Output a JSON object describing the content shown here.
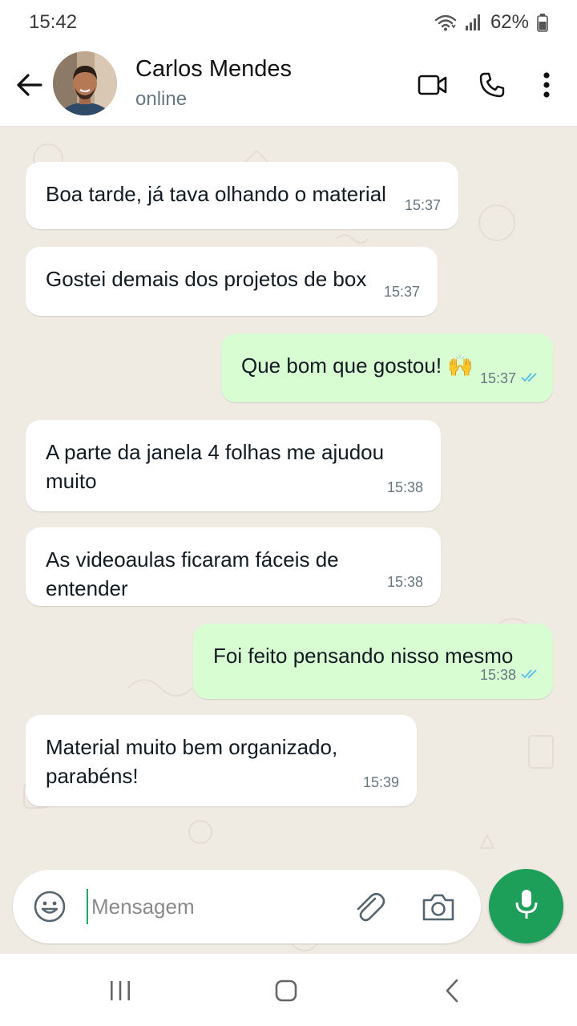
{
  "status_bar": {
    "time": "15:42",
    "battery": "62%",
    "icons": [
      "wifi-icon",
      "signal-icon",
      "battery-icon"
    ]
  },
  "header": {
    "contact_name": "Carlos Mendes",
    "contact_status": "online",
    "icons": [
      "back-arrow-icon",
      "video-call-icon",
      "voice-call-icon",
      "more-options-icon"
    ]
  },
  "messages": [
    {
      "direction": "in",
      "text": "Boa tarde, já tava olhando o material",
      "time": "15:37"
    },
    {
      "direction": "in",
      "text": "Gostei demais dos projetos de box",
      "time": "15:37"
    },
    {
      "direction": "out",
      "text": "Que bom que gostou! 🙌",
      "time": "15:37",
      "read": true
    },
    {
      "direction": "in",
      "text": "A parte da janela 4 folhas me ajudou muito",
      "time": "15:38"
    },
    {
      "direction": "in",
      "text": "As videoaulas ficaram fáceis de entender",
      "time": "15:38"
    },
    {
      "direction": "out",
      "text": "Foi feito pensando nisso mesmo",
      "time": "15:38",
      "read": true
    },
    {
      "direction": "in",
      "text": "Material muito bem organizado, parabéns!",
      "time": "15:39"
    }
  ],
  "composer": {
    "placeholder": "Mensagem",
    "icons": [
      "emoji-icon",
      "attach-icon",
      "camera-icon",
      "mic-icon"
    ]
  },
  "nav_bar": {
    "icons": [
      "recent-apps-icon",
      "home-icon",
      "back-icon"
    ]
  },
  "colors": {
    "chat_bg": "#efeae2",
    "incoming_bubble": "#ffffff",
    "outgoing_bubble": "#d9fdd3",
    "accent_green": "#1d9f5a",
    "read_tick": "#53bdeb"
  }
}
